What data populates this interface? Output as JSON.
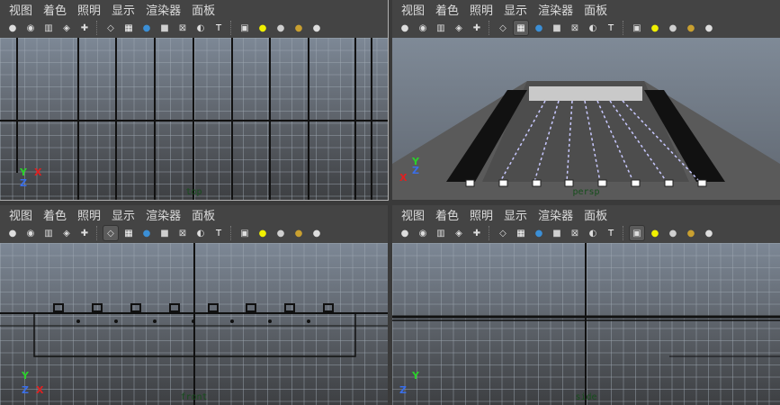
{
  "menu": [
    "视图",
    "着色",
    "照明",
    "显示",
    "渲染器",
    "面板"
  ],
  "viewports": [
    {
      "camera": "top"
    },
    {
      "camera": "persp"
    },
    {
      "camera": "front"
    },
    {
      "camera": "side"
    }
  ],
  "toolbar_icons": [
    "camera-attr-icon",
    "camera-bookmark-icon",
    "image-plane-icon",
    "select-camera-icon",
    "track-icon",
    "wireframe-icon",
    "textured-icon",
    "smooth-shade-icon",
    "flat-shade-icon",
    "bounding-box-icon",
    "xray-icon",
    "isolate-icon",
    "hardware-texture-icon",
    "default-light-icon",
    "use-all-lights-icon",
    "shadows-icon",
    "material-icon"
  ],
  "axis": {
    "x": "X",
    "y": "Y",
    "z": "Z"
  },
  "colors": {
    "x_axis": "#e02020",
    "y_axis": "#2bd02b",
    "z_axis": "#3a6ee8",
    "panel_bg": "#444444"
  }
}
